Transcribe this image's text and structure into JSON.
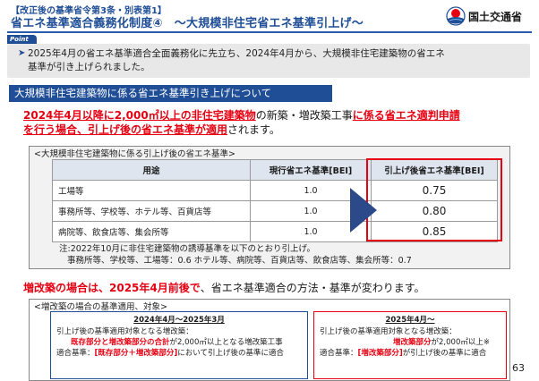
{
  "header": {
    "subtitle": "【改正後の基準省令第3条・別表第1】",
    "title": "省エネ基準適合義務化制度④　～大規模非住宅省エネ基準引上げ～",
    "org": "国土交通省"
  },
  "point": {
    "tab": "Point",
    "line1": "2025年4月の省エネ基準適合全面義務化に先立ち、2024年4月から、大規模非住宅建築物の省エネ",
    "line2": "基準が引き上げられました。"
  },
  "section_title": "大規模非住宅建築物に係る省エネ基準引き上げについて",
  "lead": {
    "p1": "2024年4月以降に2,000㎡以上の非住宅建築物",
    "p2": "の新築・増改築工事",
    "p3": "に係る省エネ適判申請",
    "p4": "を行う場合、引上げ後の省エネ基準が適用",
    "p5": "されます。"
  },
  "table_panel": {
    "caption": "<大規模非住宅建築物に係る引上げ後の省エネ基準>",
    "headers": [
      "用途",
      "現行省エネ基準[BEI]",
      "引上げ後省エネ基準[BEI]"
    ],
    "rows": [
      {
        "use": "工場等",
        "current": "1.0",
        "new": "0.75"
      },
      {
        "use": "事務所等、学校等、ホテル等、百貨店等",
        "current": "1.0",
        "new": "0.80"
      },
      {
        "use": "病院等、飲食店等、集会所等",
        "current": "1.0",
        "new": "0.85"
      }
    ],
    "note1": "注:2022年10月に非住宅建築物の誘導基準を以下のとおり引上げ。",
    "note2": "事務所等、学校等、工場等：0.6 ホテル等、病院等、百貨店等、飲食店等、集会所等：0.7"
  },
  "lead2": {
    "red": "増改築の場合は、2025年4月前後で",
    "rest": "、省エネ基準適合の方法・基準が変わります。"
  },
  "renovation_panel": {
    "caption": "<増改築の場合の基準適用、対象>",
    "left": {
      "heading": "2024年4月～2025年3月",
      "l1": "引上げ後の基準適用対象となる増改築：",
      "l2a": "既存部分と増改築部分の合計",
      "l2b": "が2,000㎡以上となる増改築工事",
      "l3a": "適合基準：",
      "l3b": "[既存部分＋増改築部分]",
      "l3c": "において引上げ後の基準に適合"
    },
    "right": {
      "heading": "2025年4月～",
      "l1": "引上げ後の基準適用対象となる増改築：",
      "l2a": "増改築部分",
      "l2b": "が2,000㎡以上※",
      "l3a": "適合基準：",
      "l3b": "[増改築部分]",
      "l3c": "が引上げ後の基準に適合"
    }
  },
  "page_number": "63",
  "colors": {
    "brand_blue": "#1f4e96",
    "accent_red": "#e60012",
    "panel_gray": "#f2f2f2"
  }
}
